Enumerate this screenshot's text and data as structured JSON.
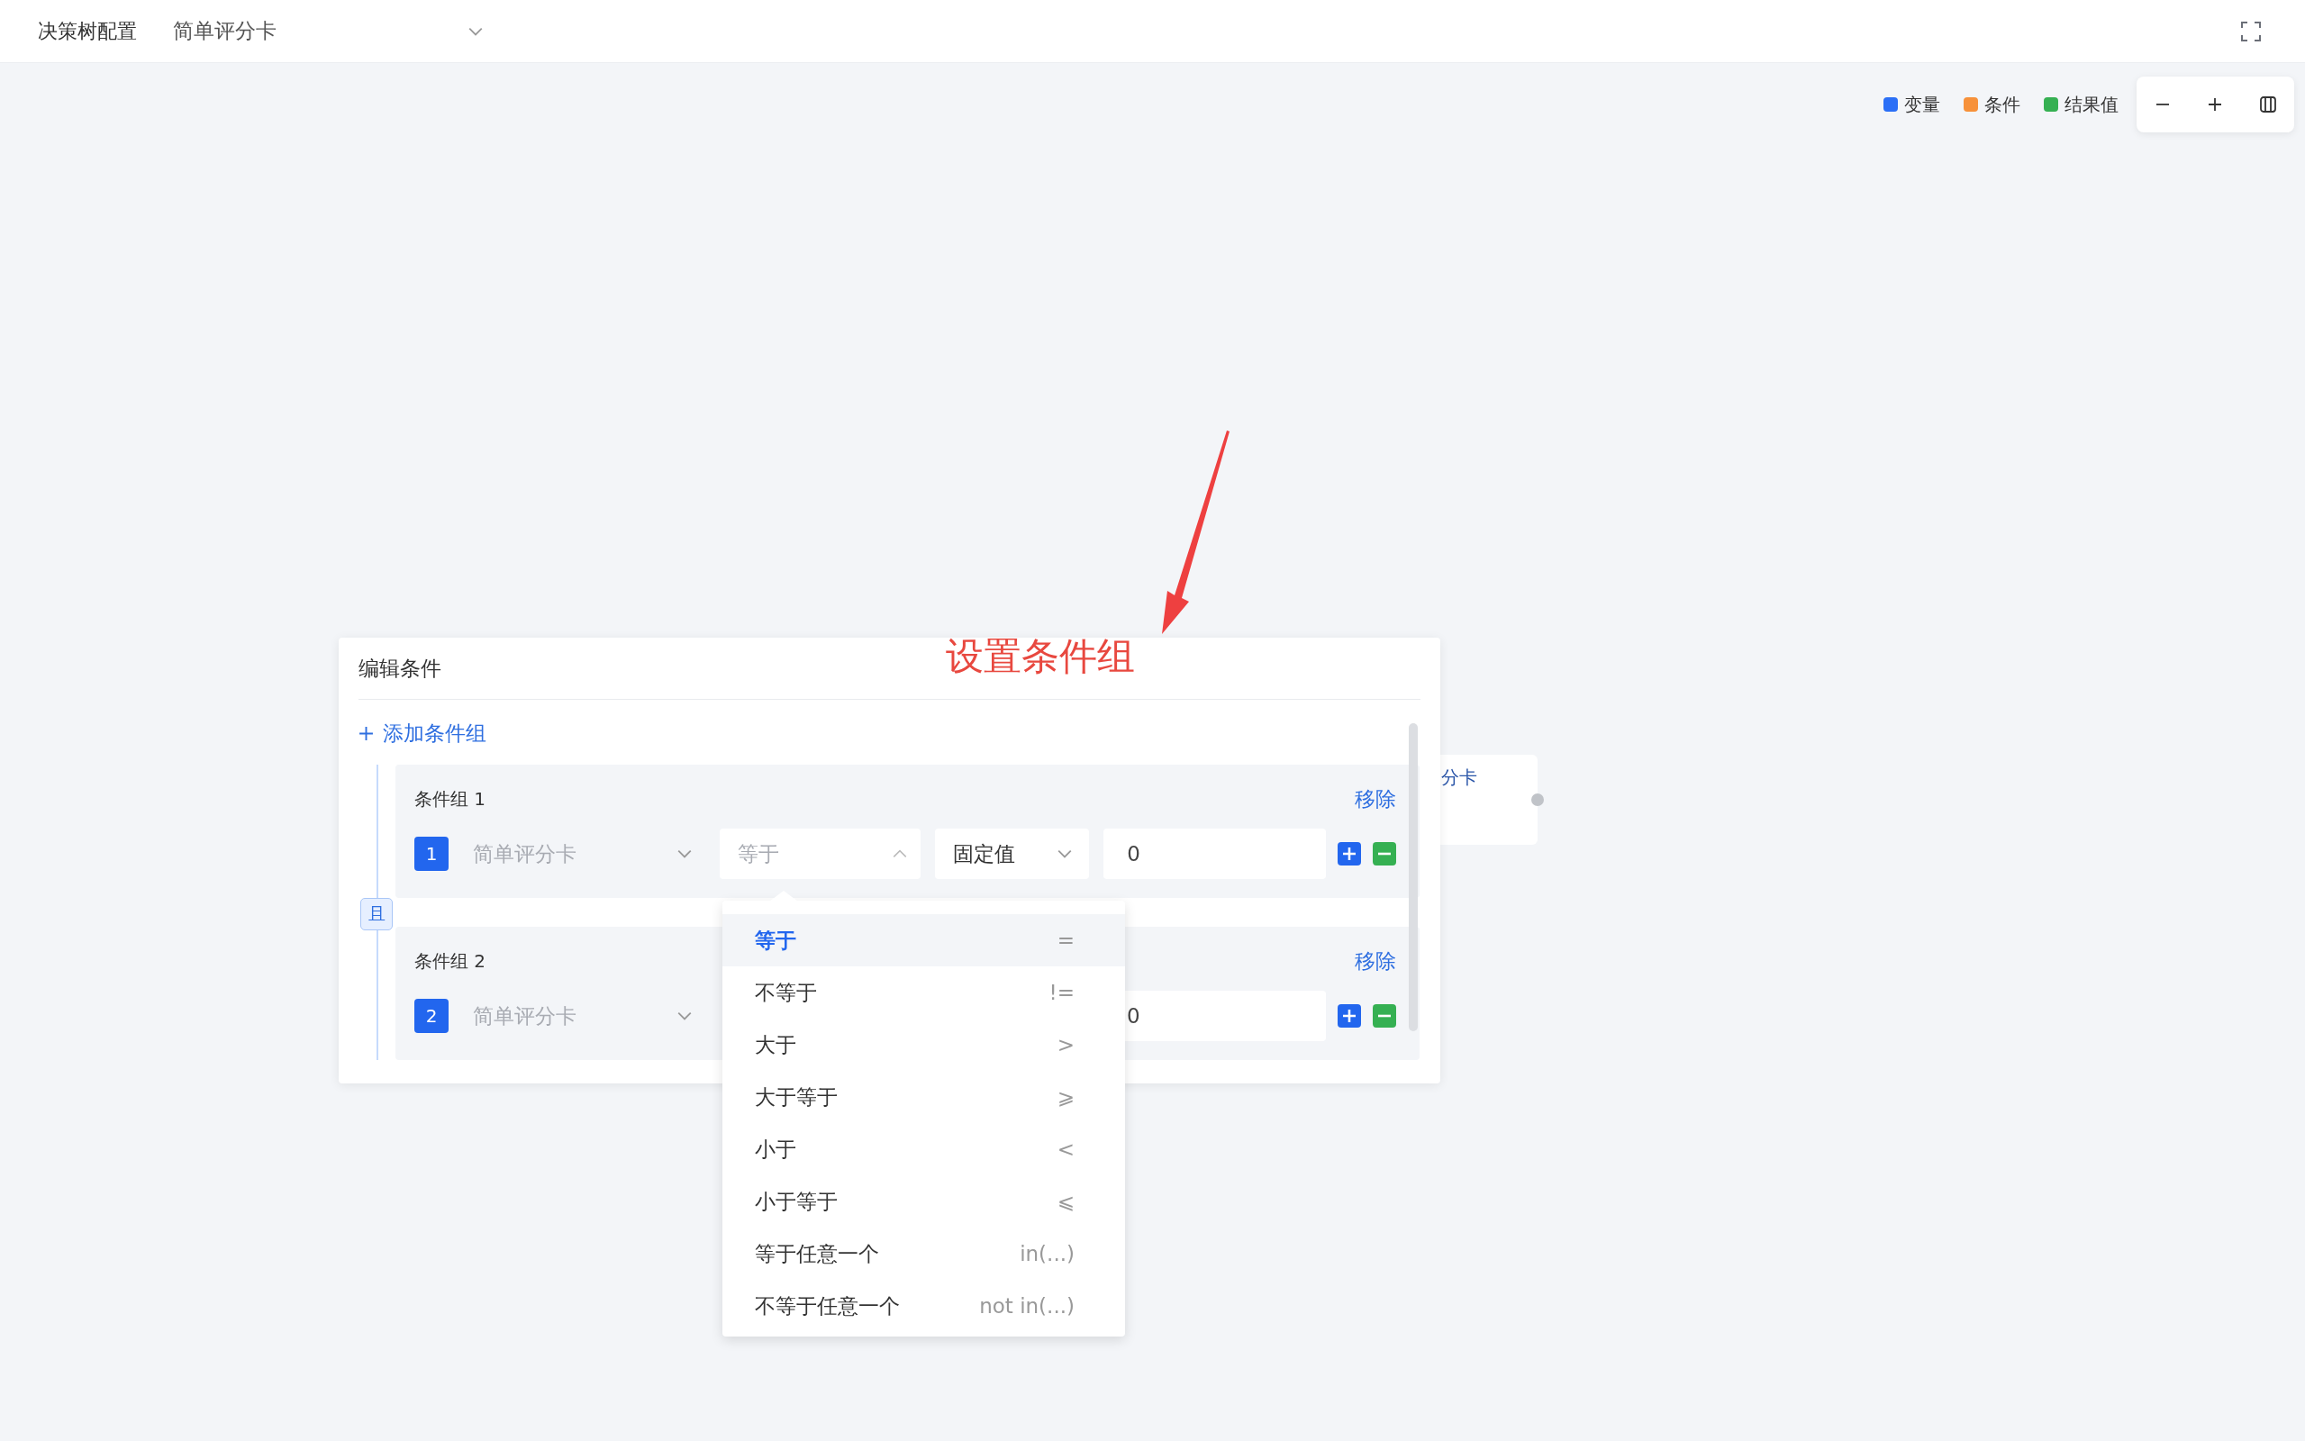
{
  "header": {
    "title": "决策树配置",
    "tree_select": {
      "value": "简单评分卡"
    }
  },
  "legend": [
    {
      "label": "变量",
      "color": "#2b6ff6"
    },
    {
      "label": "条件",
      "color": "#f7913a"
    },
    {
      "label": "结果值",
      "color": "#35b052"
    }
  ],
  "annotation": {
    "text": "设置条件组"
  },
  "node": {
    "text": "分卡"
  },
  "dialog": {
    "title": "编辑条件",
    "add_group": "添加条件组",
    "conjunction": "且",
    "groups": [
      {
        "title": "条件组 1",
        "remove": "移除",
        "conditions": [
          {
            "index": "1",
            "variable": "简单评分卡",
            "operator": "等于",
            "operator_open": true,
            "value_type": "固定值",
            "value": "0"
          }
        ]
      },
      {
        "title": "条件组 2",
        "remove": "移除",
        "conditions": [
          {
            "index": "2",
            "variable": "简单评分卡",
            "value": "0"
          }
        ]
      }
    ]
  },
  "dropdown": {
    "options": [
      {
        "label": "等于",
        "symbol": "=",
        "selected": true
      },
      {
        "label": "不等于",
        "symbol": "!=",
        "selected": false
      },
      {
        "label": "大于",
        "symbol": ">",
        "selected": false
      },
      {
        "label": "大于等于",
        "symbol": "⩾",
        "selected": false
      },
      {
        "label": "小于",
        "symbol": "<",
        "selected": false
      },
      {
        "label": "小于等于",
        "symbol": "⩽",
        "selected": false
      },
      {
        "label": "等于任意一个",
        "symbol": "in(...)",
        "selected": false
      },
      {
        "label": "不等于任意一个",
        "symbol": "not in(...)",
        "selected": false
      }
    ]
  }
}
